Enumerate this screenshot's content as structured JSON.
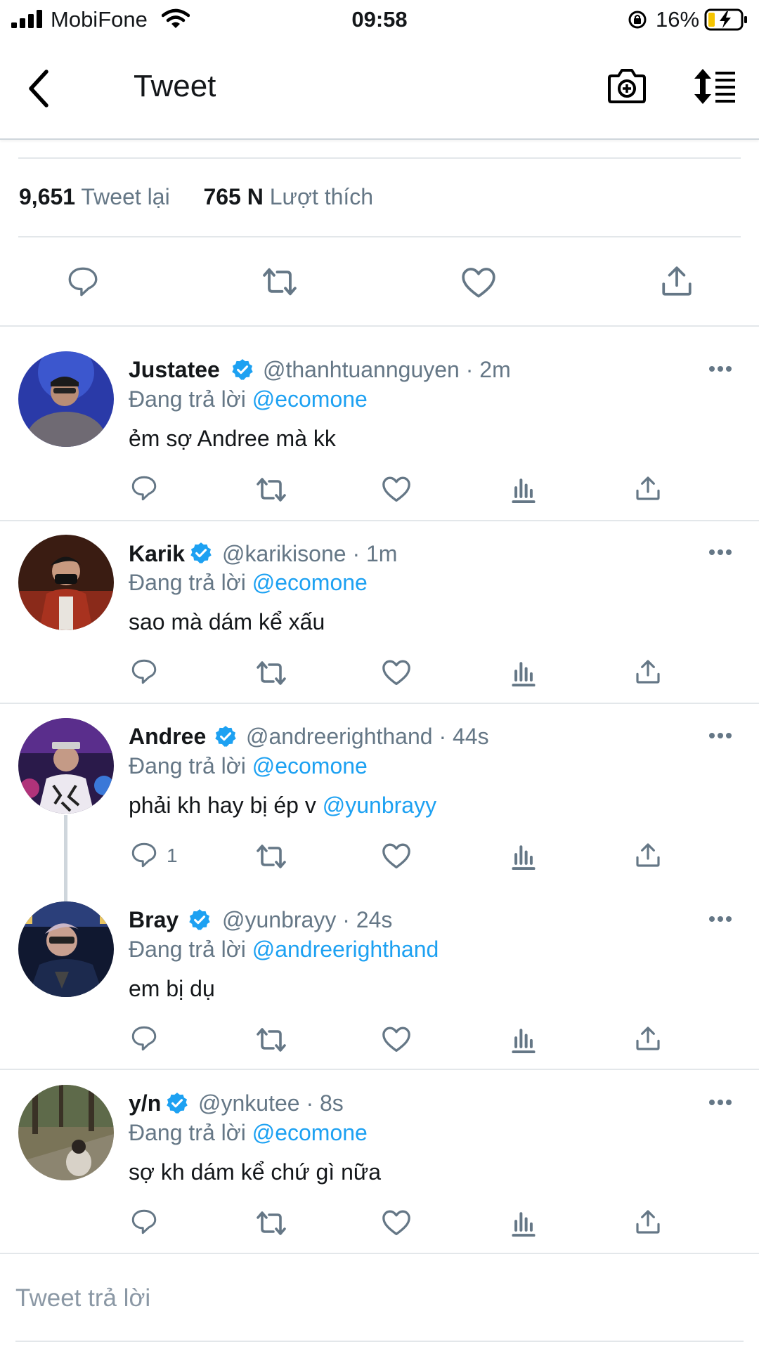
{
  "status_bar": {
    "carrier": "MobiFone",
    "time": "09:58",
    "battery_percent": "16%"
  },
  "header": {
    "title": "Tweet",
    "back_icon": "chevron-left-icon",
    "camera_icon": "camera-plus-icon",
    "sort_icon": "sort-list-icon"
  },
  "stats": {
    "retweets_count": "9,651",
    "retweets_label": "Tweet lại",
    "likes_count": "765 N",
    "likes_label": "Lượt thích"
  },
  "replies": [
    {
      "name": "Justatee",
      "handle": "@thanhtuannguyen · 2m",
      "replying_prefix": "Đang trả lời",
      "replying_to": "@ecomone",
      "text": "ẻm sợ Andree mà kk",
      "text_mention": "",
      "reply_count": ""
    },
    {
      "name": "Karik",
      "handle": "@karikisone · 1m",
      "replying_prefix": "Đang trả lời",
      "replying_to": "@ecomone",
      "text": "sao mà dám kể xấu",
      "text_mention": "",
      "reply_count": ""
    },
    {
      "name": "Andree",
      "handle": "@andreerighthand · 44s",
      "replying_prefix": "Đang trả lời",
      "replying_to": "@ecomone",
      "text": "phải kh hay bị ép v",
      "text_mention": "@yunbrayy",
      "reply_count": "1"
    },
    {
      "name": "Bray",
      "handle": "@yunbrayy · 24s",
      "replying_prefix": "Đang trả lời",
      "replying_to": "@andreerighthand",
      "text": "em bị dụ",
      "text_mention": "",
      "reply_count": ""
    },
    {
      "name": "y/n",
      "handle": "@ynkutee · 8s",
      "replying_prefix": "Đang trả lời",
      "replying_to": "@ecomone",
      "text": "sợ kh dám kể chứ gì nữa",
      "text_mention": "",
      "reply_count": ""
    }
  ],
  "compose": {
    "placeholder": "Tweet trả lời"
  },
  "colors": {
    "accent": "#1da1f2",
    "secondary_text": "#657786",
    "primary_text": "#14171a",
    "verified": "#1da1f2"
  }
}
